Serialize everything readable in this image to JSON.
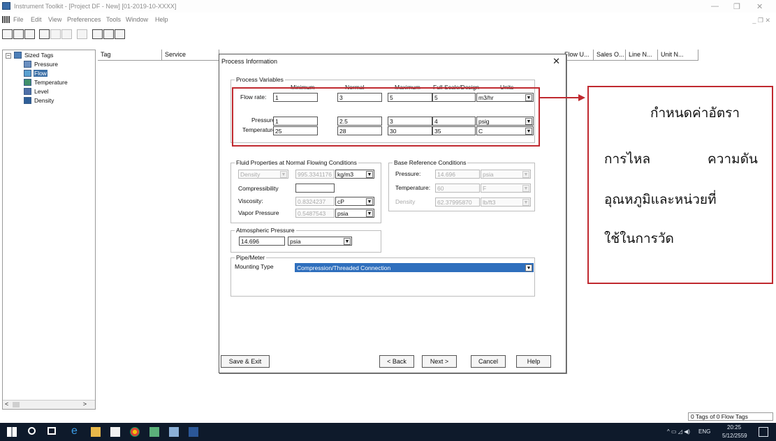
{
  "window": {
    "title": "Instrument Toolkit - [Project DF - New] [01-2019-10-XXXX]",
    "menus": [
      "File",
      "Edit",
      "View",
      "Preferences",
      "Tools",
      "Window",
      "Help"
    ]
  },
  "tree": {
    "root": "Sized Tags",
    "items": [
      "Pressure",
      "Flow",
      "Temperature",
      "Level",
      "Density"
    ],
    "selected": "Flow",
    "collapse_glyph": "−",
    "scroll_left": "<",
    "scroll_right": ">"
  },
  "grid": {
    "columns": [
      "Tag",
      "Service",
      "Flow U...",
      "Sales O...",
      "Line N...",
      "Unit N..."
    ]
  },
  "dialog": {
    "title": "Process Information",
    "close": "✕",
    "process_variables": {
      "title": "Process Variables",
      "col_headers": [
        "Minimum",
        "Normal",
        "Maximum",
        "Full Scale/Design",
        "Units"
      ],
      "flow_rate": {
        "label": "Flow rate:",
        "values": [
          "1",
          "3",
          "5",
          "5"
        ],
        "unit": "m3/hr"
      },
      "pressure": {
        "label": "Pressure:",
        "values": [
          "1",
          "2.5",
          "3",
          "4"
        ],
        "unit": "psig"
      },
      "temperature": {
        "label": "Temperature:",
        "values": [
          "25",
          "28",
          "30",
          "35"
        ],
        "unit": "C"
      }
    },
    "fluid_properties": {
      "title": "Fluid Properties at Normal Flowing Conditions",
      "density": {
        "label": "Density",
        "value": "995.3341176",
        "unit": "kg/m3"
      },
      "compressibility": {
        "label": "Compressibility",
        "value": ""
      },
      "viscosity": {
        "label": "Viscosity:",
        "value": "0.8324237",
        "unit": "cP"
      },
      "vapor_pressure": {
        "label": "Vapor Pressure",
        "value": "0.5487543",
        "unit": "psia"
      }
    },
    "base_reference": {
      "title": "Base Reference Conditions",
      "pressure": {
        "label": "Pressure:",
        "value": "14.696",
        "unit": "psia"
      },
      "temperature": {
        "label": "Temperature:",
        "value": "60",
        "unit": "F"
      },
      "density": {
        "label": "Density",
        "value": "62.37995870",
        "unit": "lb/ft3"
      }
    },
    "atmospheric": {
      "title": "Atmospheric Pressure",
      "value": "14.696",
      "unit": "psia"
    },
    "pipe_meter": {
      "title": "Pipe/Meter",
      "label": "Mounting Type",
      "value": "Compression/Threaded Connection"
    },
    "buttons": {
      "save_exit": "Save & Exit",
      "back": "< Back",
      "next": "Next >",
      "cancel": "Cancel",
      "help": "Help"
    }
  },
  "annotation": {
    "lines": [
      "กำหนดค่าอัตรา",
      "การไหล",
      "ความดัน",
      "อุณหภูมิและหน่วยที่",
      "ใช้ในการวัด"
    ],
    "color": "#c0292f"
  },
  "status": {
    "text": "0 Tags of 0 Flow Tags"
  },
  "taskbar": {
    "lang": "ENG",
    "time": "20:25",
    "date": "5/12/2559"
  }
}
